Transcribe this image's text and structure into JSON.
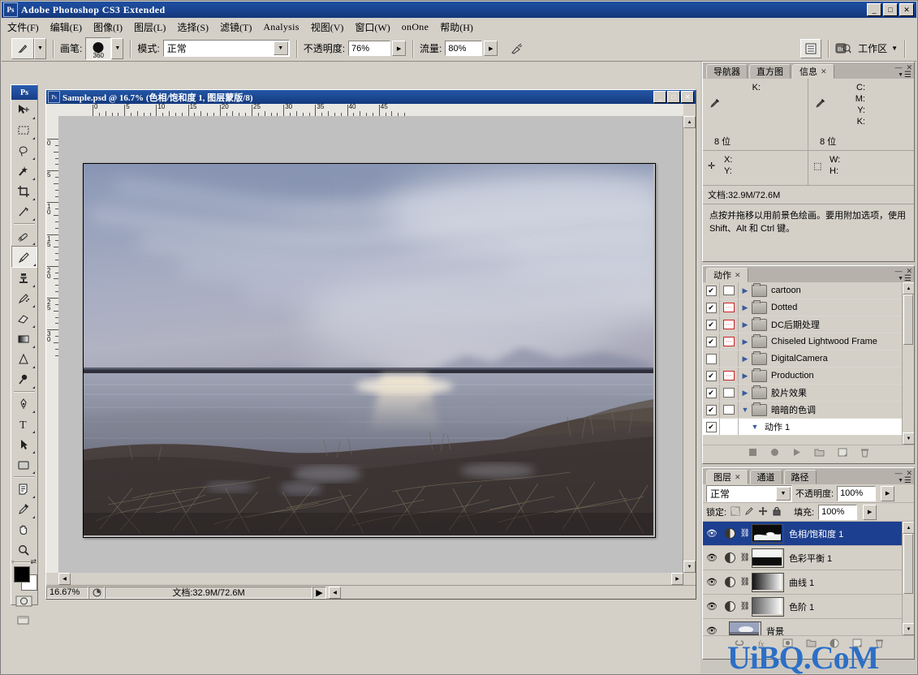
{
  "app": {
    "title": "Adobe Photoshop CS3 Extended",
    "ps_badge": "Ps",
    "window_buttons": {
      "minimize": "_",
      "maximize": "□",
      "close": "✕"
    }
  },
  "menubar": [
    {
      "label": "文件(F)"
    },
    {
      "label": "编辑(E)"
    },
    {
      "label": "图像(I)"
    },
    {
      "label": "图层(L)"
    },
    {
      "label": "选择(S)"
    },
    {
      "label": "滤镜(T)"
    },
    {
      "label": "Analysis"
    },
    {
      "label": "视图(V)"
    },
    {
      "label": "窗口(W)"
    },
    {
      "label": "onOne"
    },
    {
      "label": "帮助(H)"
    }
  ],
  "options_bar": {
    "tool_icon": "brush-tool",
    "brush_label": "画笔:",
    "brush_size": "360",
    "mode_label": "模式:",
    "mode_value": "正常",
    "opacity_label": "不透明度:",
    "opacity_value": "76%",
    "flow_label": "流量:",
    "flow_value": "80%",
    "airbrush_icon": "airbrush-icon",
    "palette_icon": "palettes-icon",
    "bridge_icon": "bridge-icon",
    "workspace_label": "工作区",
    "workspace_caret": "▼"
  },
  "toolbox": {
    "header": "Ps",
    "tools": [
      {
        "name": "move-tool",
        "glyph": "✥"
      },
      {
        "name": "marquee-tool",
        "glyph": "▭"
      },
      {
        "name": "lasso-tool",
        "glyph": "◠"
      },
      {
        "name": "magic-wand-tool",
        "glyph": "✳"
      },
      {
        "name": "crop-tool",
        "glyph": "⌗"
      },
      {
        "name": "slice-tool",
        "glyph": "✂"
      },
      {
        "name": "healing-brush-tool",
        "glyph": "⌇"
      },
      {
        "name": "brush-tool",
        "glyph": "🖌",
        "selected": true
      },
      {
        "name": "clone-stamp-tool",
        "glyph": "⎙"
      },
      {
        "name": "history-brush-tool",
        "glyph": "↯"
      },
      {
        "name": "eraser-tool",
        "glyph": "▱"
      },
      {
        "name": "gradient-tool",
        "glyph": "▬"
      },
      {
        "name": "blur-tool",
        "glyph": "△"
      },
      {
        "name": "dodge-tool",
        "glyph": "●"
      },
      {
        "name": "pen-tool",
        "glyph": "✒"
      },
      {
        "name": "type-tool",
        "glyph": "T"
      },
      {
        "name": "path-selection-tool",
        "glyph": "➤"
      },
      {
        "name": "shape-tool",
        "glyph": "▣"
      },
      {
        "name": "notes-tool",
        "glyph": "🗎"
      },
      {
        "name": "eyedropper-tool",
        "glyph": "⚲"
      },
      {
        "name": "hand-tool",
        "glyph": "✋"
      },
      {
        "name": "zoom-tool",
        "glyph": "🔍"
      }
    ],
    "foreground_color": "#000000",
    "background_color": "#ffffff",
    "quickmask_label": "quick-mask-mode"
  },
  "document": {
    "title": "Sample.psd @ 16.7% (色相/饱和度 1, 图层蒙版/8)",
    "zoom": "16.67%",
    "doc_size": "文档:32.9M/72.6M",
    "ruler_h_labels": [
      "0",
      "5",
      "10",
      "15",
      "20",
      "25",
      "30",
      "35",
      "40",
      "45"
    ],
    "ruler_v_labels": [
      "0",
      "5",
      "10",
      "15",
      "20",
      "25",
      "30"
    ],
    "window_buttons": {
      "minimize": "_",
      "maximize": "□",
      "close": "✕"
    }
  },
  "info_panel": {
    "tabs": [
      {
        "label": "导航器",
        "active": false
      },
      {
        "label": "直方图",
        "active": false
      },
      {
        "label": "信息",
        "active": true,
        "closable": true
      }
    ],
    "left_readout": [
      "K:"
    ],
    "left_bits": "8 位",
    "right_readout": [
      "C:",
      "M:",
      "Y:",
      "K:"
    ],
    "right_bits": "8 位",
    "coords": [
      "X:",
      "Y:"
    ],
    "size": [
      "W:",
      "H:"
    ],
    "doc_line": "文档:32.9M/72.6M",
    "hint": "点按并拖移以用前景色绘画。要用附加选项，使用 Shift、Alt 和 Ctrl 键。"
  },
  "actions_panel": {
    "tabs": [
      {
        "label": "动作",
        "active": true,
        "closable": true
      }
    ],
    "rows": [
      {
        "name": "cartoon",
        "checked": true,
        "dialog": "off",
        "type": "set"
      },
      {
        "name": "Dotted",
        "checked": true,
        "dialog": "red",
        "type": "set"
      },
      {
        "name": "DC后期处理",
        "checked": true,
        "dialog": "red",
        "type": "set"
      },
      {
        "name": "Chiseled Lightwood Frame",
        "checked": true,
        "dialog": "red",
        "type": "set"
      },
      {
        "name": "DigitalCamera",
        "checked": false,
        "dialog": "none",
        "type": "set"
      },
      {
        "name": "Production",
        "checked": true,
        "dialog": "red",
        "type": "set"
      },
      {
        "name": "胶片效果",
        "checked": true,
        "dialog": "off",
        "type": "set"
      },
      {
        "name": "暗暗的色调",
        "checked": true,
        "dialog": "off",
        "type": "set",
        "expanded": true
      },
      {
        "name": "动作 1",
        "checked": true,
        "dialog": "off",
        "type": "action",
        "expanded": true,
        "highlight": true
      }
    ],
    "footer_icons": [
      "stop-icon",
      "record-icon",
      "play-icon",
      "new-set-icon",
      "new-action-icon",
      "delete-icon"
    ]
  },
  "layers_panel": {
    "tabs": [
      {
        "label": "图层",
        "active": true,
        "closable": true
      },
      {
        "label": "通道",
        "active": false
      },
      {
        "label": "路径",
        "active": false
      }
    ],
    "blend_mode": "正常",
    "opacity_label": "不透明度:",
    "opacity_value": "100%",
    "lock_label": "锁定:",
    "lock_icons": [
      "lock-transparency-icon",
      "lock-image-icon",
      "lock-position-icon",
      "lock-all-icon"
    ],
    "fill_label": "填充:",
    "fill_value": "100%",
    "rows": [
      {
        "name": "色相/饱和度 1",
        "selected": true,
        "visible": true,
        "kind": "adjustment",
        "mask": "dark"
      },
      {
        "name": "色彩平衡 1",
        "selected": false,
        "visible": true,
        "kind": "adjustment",
        "mask": "split"
      },
      {
        "name": "曲线 1",
        "selected": false,
        "visible": true,
        "kind": "adjustment",
        "mask": "grad-dark"
      },
      {
        "name": "色阶 1",
        "selected": false,
        "visible": true,
        "kind": "adjustment",
        "mask": "grad-light"
      },
      {
        "name": "背景",
        "selected": false,
        "visible": true,
        "kind": "image",
        "mask": "photo"
      }
    ],
    "footer_icons": [
      "link-icon",
      "fx-icon",
      "mask-icon",
      "group-icon",
      "adjustment-icon",
      "new-layer-icon",
      "delete-icon"
    ]
  },
  "watermark": {
    "text": "UiBQ.CoM",
    "color": "#2d6fc4"
  }
}
